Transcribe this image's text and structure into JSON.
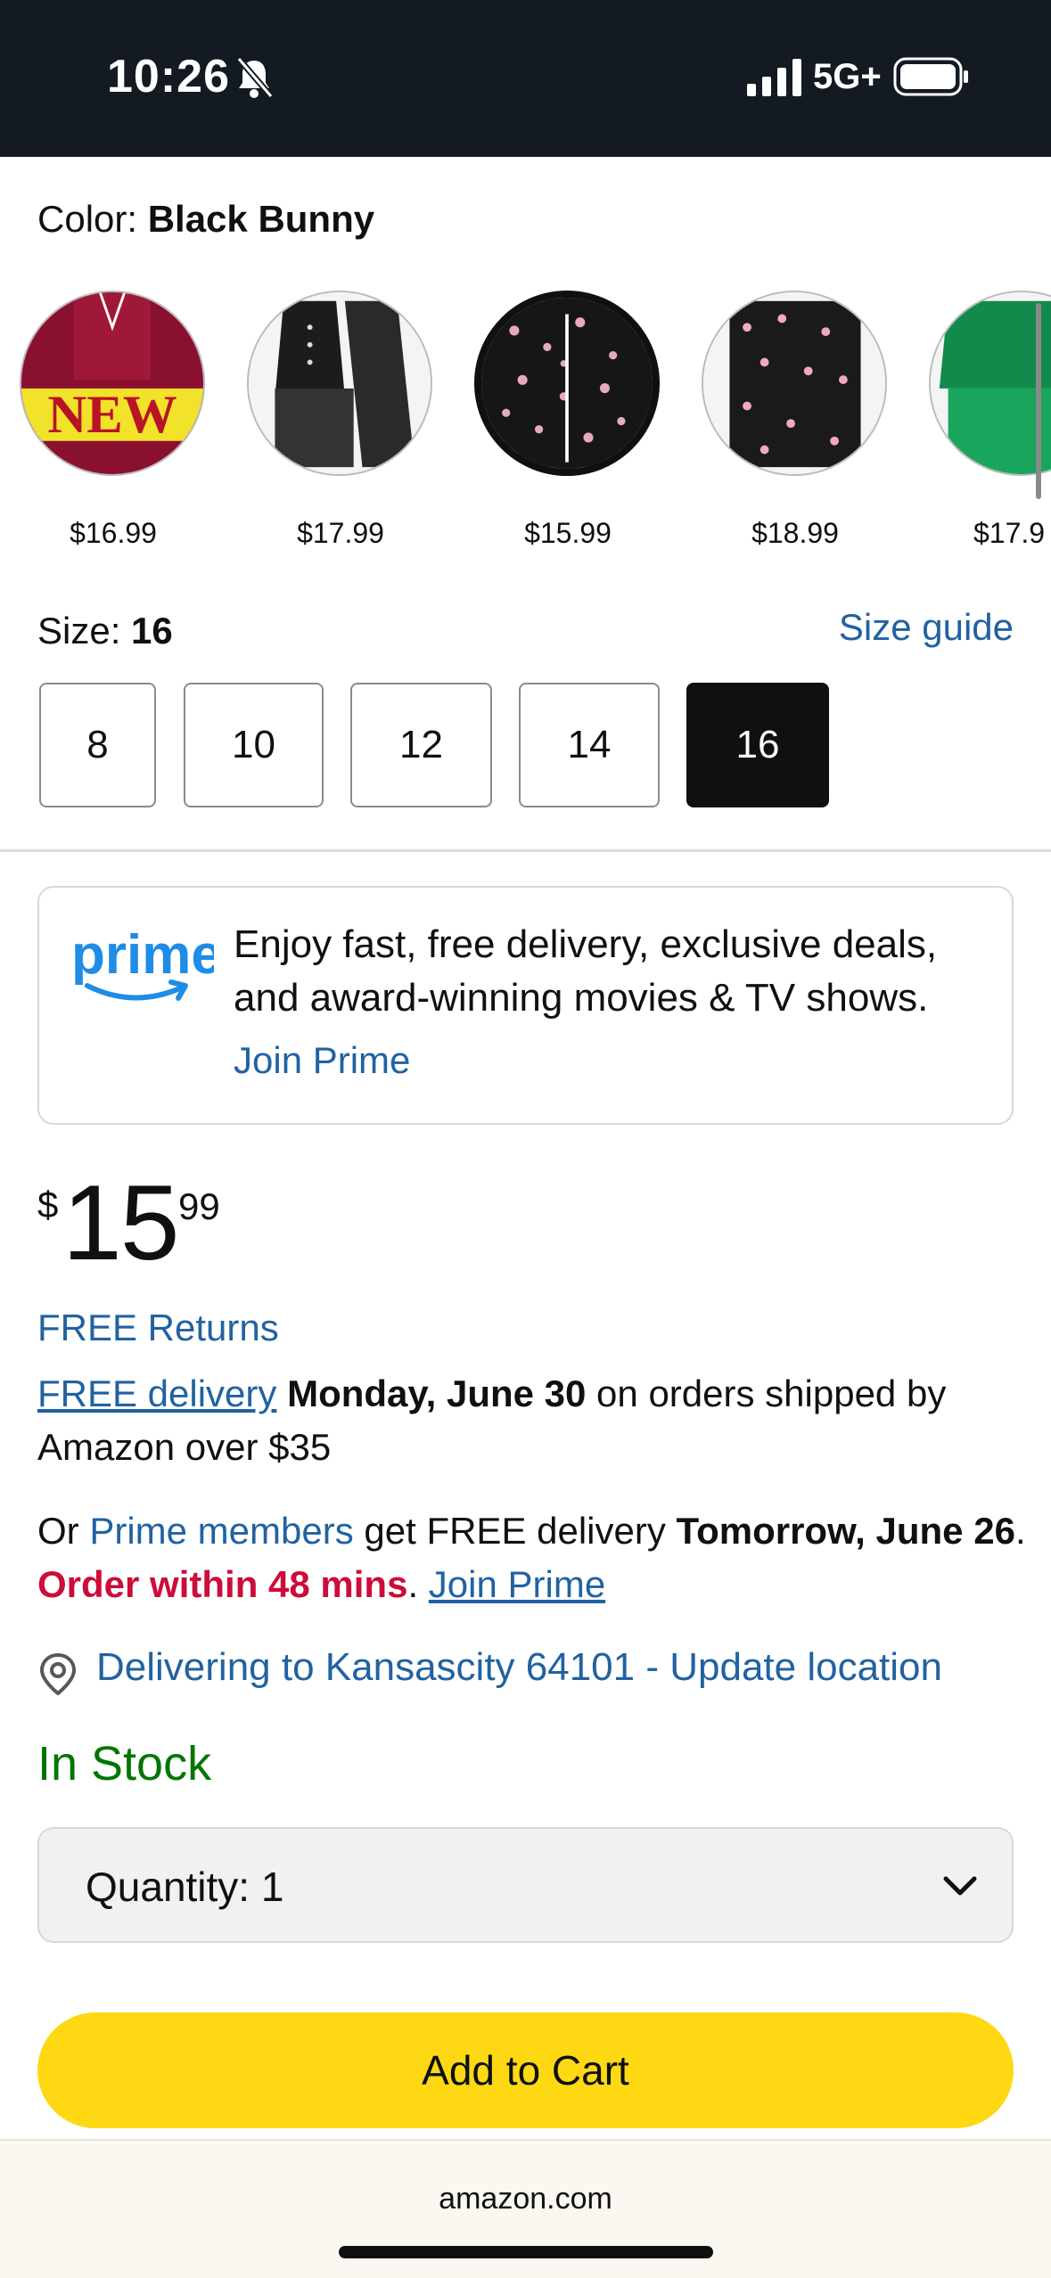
{
  "status_bar": {
    "time": "10:26",
    "network": "5G+",
    "icons": [
      "bell-slash-icon",
      "signal-icon",
      "battery-icon"
    ]
  },
  "color": {
    "label": "Color: ",
    "value": "Black Bunny",
    "swatches": [
      {
        "price": "$16.99",
        "badge_text": "NEW",
        "colors": [
          "#8a1030",
          "#f2e22a"
        ]
      },
      {
        "price": "$17.99",
        "colors": [
          "#1c1c1c",
          "#3a3a3a"
        ]
      },
      {
        "price": "$15.99",
        "colors": [
          "#111111",
          "#e8a9bd"
        ],
        "selected": true
      },
      {
        "price": "$18.99",
        "colors": [
          "#1a1a1a",
          "#f0a8c8"
        ]
      },
      {
        "price": "$17.9",
        "colors": [
          "#138a4c",
          "#1aa55c"
        ]
      }
    ]
  },
  "size": {
    "label": "Size: ",
    "value": "16",
    "guide_link": "Size guide",
    "options": [
      "8",
      "10",
      "12",
      "14",
      "16"
    ],
    "selected": "16"
  },
  "prime": {
    "logo_text": "prime",
    "text": "Enjoy fast, free delivery, exclusive deals, and award-winning movies & TV shows.",
    "join_link": "Join Prime"
  },
  "price": {
    "symbol": "$",
    "whole": "15",
    "fraction": "99"
  },
  "shipping": {
    "free_returns": "FREE Returns",
    "free_delivery_link": "FREE delivery",
    "delivery_date": "Monday, June 30",
    "delivery_rest": " on orders shipped by Amazon over $35",
    "prime_prefix": "Or ",
    "prime_members_link": "Prime members",
    "prime_mid": " get FREE delivery ",
    "prime_date": "Tomorrow, June 26",
    "prime_dot": ". ",
    "order_within": "Order within 48 mins",
    "prime_dot2": ". ",
    "join_prime_link": "Join Prime"
  },
  "location": {
    "text": "Delivering to Kansascity 64101 - Update location"
  },
  "stock": {
    "status": "In Stock"
  },
  "quantity": {
    "label": "Quantity:",
    "value": "1"
  },
  "cart": {
    "add_label": "Add to Cart"
  },
  "browser": {
    "domain": "amazon.com"
  },
  "colors": {
    "link": "#2162a1",
    "in_stock": "#007600",
    "urgent": "#cc0c39",
    "add_to_cart": "#ffd814",
    "status_bar": "#131a22"
  }
}
